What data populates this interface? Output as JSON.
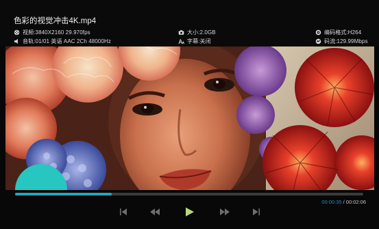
{
  "player": {
    "title": "色彩的视觉冲击4K.mp4",
    "info": {
      "video": "视频:3840X2160  29.970fps",
      "audio": "音轨:01/01 英语  AAC 2Ch 48000Hz",
      "size": "大小:2.0GB",
      "subtitle": "字幕:关闭",
      "codec": "编码格式:H264",
      "bitrate": "码流:129.99Mbps"
    },
    "progress": {
      "current": "00:00:35",
      "separator": " / ",
      "total": "00:02:06",
      "fraction": 0.277
    },
    "controls": {
      "prev": "skip-previous",
      "rewind": "rewind",
      "play": "play",
      "forward": "fast-forward",
      "next": "skip-next"
    },
    "colors": {
      "accent": "#2aa3b8",
      "time_current": "#1e8fbe",
      "play_button": "#b8d87a",
      "controls_dim": "#6e6e6e"
    }
  }
}
